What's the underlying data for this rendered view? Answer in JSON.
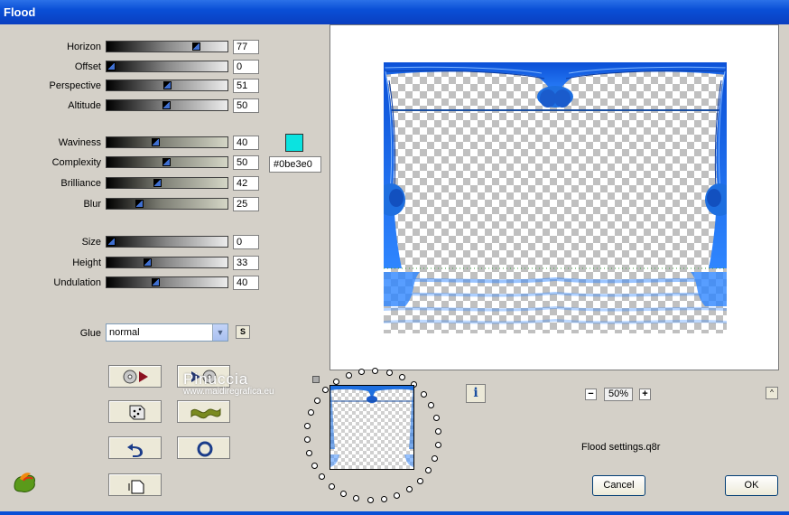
{
  "window": {
    "title": "Flood"
  },
  "sliders": [
    {
      "label": "Horizon",
      "value": "77",
      "fraction": 0.77,
      "style": "gray"
    },
    {
      "label": "Offset",
      "value": "0",
      "fraction": 0.0,
      "style": "gray"
    },
    {
      "label": "Perspective",
      "value": "51",
      "fraction": 0.51,
      "style": "gray"
    },
    {
      "label": "Altitude",
      "value": "50",
      "fraction": 0.5,
      "style": "gray"
    },
    {
      "label": "Waviness",
      "value": "40",
      "fraction": 0.4,
      "style": "tint"
    },
    {
      "label": "Complexity",
      "value": "50",
      "fraction": 0.5,
      "style": "tint"
    },
    {
      "label": "Brilliance",
      "value": "42",
      "fraction": 0.42,
      "style": "tint"
    },
    {
      "label": "Blur",
      "value": "25",
      "fraction": 0.25,
      "style": "tint"
    },
    {
      "label": "Size",
      "value": "0",
      "fraction": 0.0,
      "style": "gray"
    },
    {
      "label": "Height",
      "value": "33",
      "fraction": 0.33,
      "style": "gray"
    },
    {
      "label": "Undulation",
      "value": "40",
      "fraction": 0.4,
      "style": "gray"
    }
  ],
  "color": {
    "swatch": "#0be3e0",
    "hex_text": "#0be3e0"
  },
  "glue": {
    "label": "Glue",
    "value": "normal",
    "s_button": "S"
  },
  "toolbar": {
    "buttons": [
      {
        "name": "load-preset-button",
        "icon": "disc-arrow-icon"
      },
      {
        "name": "save-preset-button",
        "icon": "arrow-disc-icon"
      },
      {
        "name": "randomize-button",
        "icon": "dice-icon"
      },
      {
        "name": "wave-button",
        "icon": "wave-icon"
      },
      {
        "name": "reset-button",
        "icon": "undo-icon"
      },
      {
        "name": "circle-button",
        "icon": "ring-icon"
      },
      {
        "name": "copy-button",
        "icon": "document-icon"
      }
    ]
  },
  "watermark": {
    "line1": "Pinuccia",
    "line2": "www.maidiregrafica.eu"
  },
  "zoom": {
    "minus": "−",
    "value": "50%",
    "plus": "+"
  },
  "info": {
    "label": "i"
  },
  "navigator": {
    "caret": "^"
  },
  "settings_file": "Flood settings.q8r",
  "buttons": {
    "cancel": "Cancel",
    "ok": "OK"
  },
  "colors": {
    "accent": "#0a4fd6",
    "flood_blue": "#1e6fe0",
    "dialog_bg": "#d4d0c8"
  }
}
